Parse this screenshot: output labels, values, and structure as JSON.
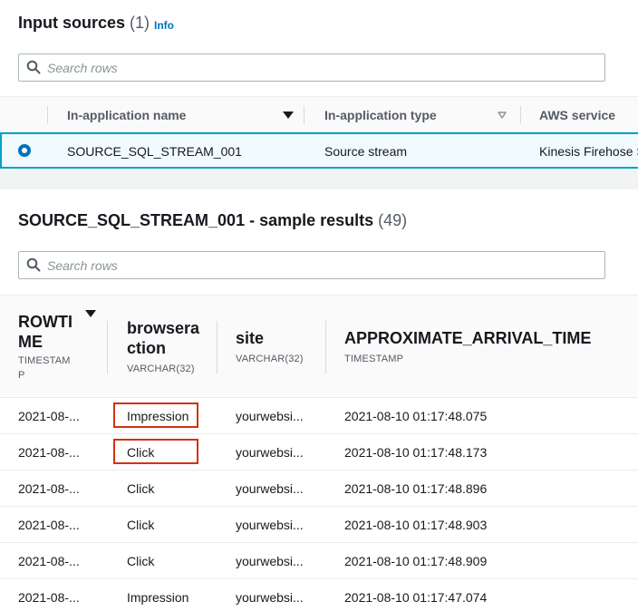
{
  "input_sources": {
    "title": "Input sources",
    "count": "(1)",
    "info_label": "Info",
    "search_placeholder": "Search rows",
    "columns": [
      "In-application name",
      "In-application type",
      "AWS service"
    ],
    "row": {
      "name": "SOURCE_SQL_STREAM_001",
      "type": "Source stream",
      "service": "Kinesis Firehose S",
      "selected": true
    }
  },
  "sample_results": {
    "title": "SOURCE_SQL_STREAM_001 - sample results",
    "count": "(49)",
    "search_placeholder": "Search rows",
    "columns": [
      {
        "title_l1": "ROWTI",
        "title_l2": "ME",
        "type_l1": "TIMESTAM",
        "type_l2": "P"
      },
      {
        "title_l1": "browsera",
        "title_l2": "ction",
        "type_l1": "VARCHAR(32)",
        "type_l2": ""
      },
      {
        "title_l1": "site",
        "title_l2": "",
        "type_l1": "VARCHAR(32)",
        "type_l2": ""
      },
      {
        "title_l1": "APPROXIMATE_ARRIVAL_TIME",
        "title_l2": "",
        "type_l1": "TIMESTAMP",
        "type_l2": ""
      }
    ],
    "rows": [
      {
        "rowtime": "2021-08-...",
        "action": "Impression",
        "site": "yourwebsi...",
        "arrival": "2021-08-10 01:17:48.075",
        "highlighted": true
      },
      {
        "rowtime": "2021-08-...",
        "action": "Click",
        "site": "yourwebsi...",
        "arrival": "2021-08-10 01:17:48.173",
        "highlighted": true
      },
      {
        "rowtime": "2021-08-...",
        "action": "Click",
        "site": "yourwebsi...",
        "arrival": "2021-08-10 01:17:48.896",
        "highlighted": false
      },
      {
        "rowtime": "2021-08-...",
        "action": "Click",
        "site": "yourwebsi...",
        "arrival": "2021-08-10 01:17:48.903",
        "highlighted": false
      },
      {
        "rowtime": "2021-08-...",
        "action": "Click",
        "site": "yourwebsi...",
        "arrival": "2021-08-10 01:17:48.909",
        "highlighted": false
      },
      {
        "rowtime": "2021-08-...",
        "action": "Impression",
        "site": "yourwebsi...",
        "arrival": "2021-08-10 01:17:47.074",
        "highlighted": false
      }
    ]
  },
  "colors": {
    "selected_border": "#00a1c9",
    "radio": "#0073bb",
    "highlight_box": "#d13212",
    "info_link": "#0073bb"
  }
}
